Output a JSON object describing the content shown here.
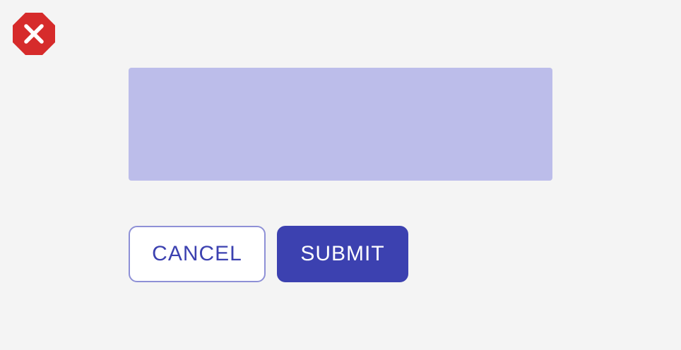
{
  "icons": {
    "close": "close-icon"
  },
  "colors": {
    "background": "#f4f4f4",
    "close_red": "#d62b2b",
    "panel_fill": "#bcbdea",
    "primary": "#3c41b0",
    "outline": "#8e90d6"
  },
  "actions": {
    "cancel_label": "CANCEL",
    "submit_label": "SUBMIT"
  }
}
